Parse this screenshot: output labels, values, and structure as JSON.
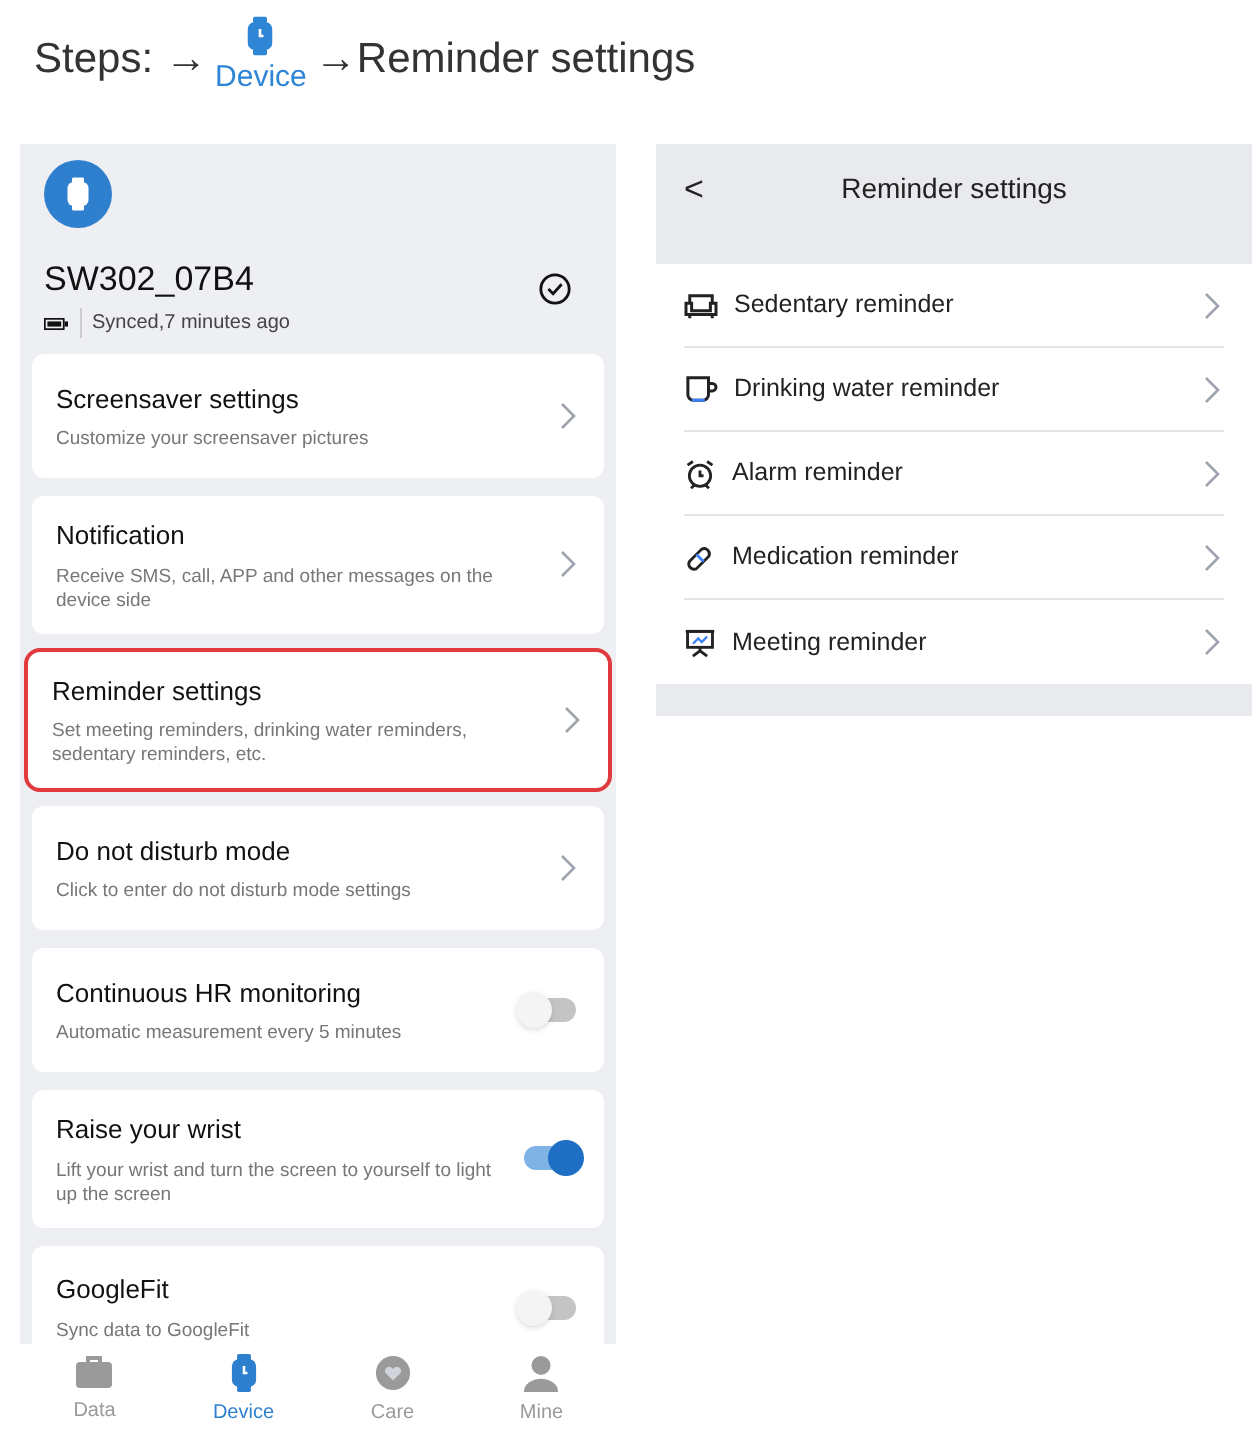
{
  "steps": {
    "label": "Steps:",
    "arrow_1": "→",
    "nav_label": "Device",
    "arrow_2": "→",
    "target": "Reminder settings"
  },
  "device": {
    "name": "SW302_07B4",
    "sync_status": "Synced,7 minutes ago"
  },
  "settings": [
    {
      "kind": "link",
      "title": "Screensaver settings",
      "description": "Customize your screensaver pictures",
      "highlighted": false
    },
    {
      "kind": "link",
      "title": "Notification",
      "description": "Receive SMS, call, APP and other messages on the device side",
      "highlighted": false
    },
    {
      "kind": "link",
      "title": "Reminder settings",
      "description": "Set meeting reminders, drinking water reminders, sedentary reminders, etc.",
      "highlighted": true
    },
    {
      "kind": "link",
      "title": "Do not disturb mode",
      "description": "Click to enter do not disturb mode settings",
      "highlighted": false
    },
    {
      "kind": "toggle",
      "title": "Continuous HR monitoring",
      "description": "Automatic measurement every 5 minutes",
      "on": false,
      "highlighted": false
    },
    {
      "kind": "toggle",
      "title": "Raise your wrist",
      "description": "Lift your wrist and turn the screen to yourself to light up the screen",
      "on": true,
      "highlighted": false
    },
    {
      "kind": "toggle",
      "title": "GoogleFit",
      "description": "Sync data to GoogleFit",
      "on": false,
      "highlighted": false
    }
  ],
  "bottom_nav": [
    {
      "kind": "data",
      "label": "Data",
      "selected": false
    },
    {
      "kind": "device",
      "label": "Device",
      "selected": true
    },
    {
      "kind": "care",
      "label": "Care",
      "selected": false
    },
    {
      "kind": "mine",
      "label": "Mine",
      "selected": false
    }
  ],
  "reminder_screen": {
    "back": "<",
    "title": "Reminder settings",
    "items": [
      {
        "kind": "sedentary",
        "label": "Sedentary reminder"
      },
      {
        "kind": "water",
        "label": "Drinking water reminder"
      },
      {
        "kind": "alarm",
        "label": "Alarm reminder"
      },
      {
        "kind": "medication",
        "label": "Medication reminder"
      },
      {
        "kind": "meeting",
        "label": "Meeting reminder"
      }
    ]
  }
}
